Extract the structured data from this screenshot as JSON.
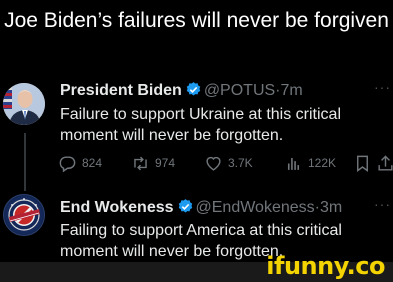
{
  "headline": "Joe Biden’s failures will never be forgiven",
  "tweets": [
    {
      "display_name": "President Biden",
      "handle": "@POTUS",
      "separator": "·",
      "time": "7m",
      "more": "···",
      "text_lines": [
        "Failure to support Ukraine at this critical",
        "moment will never be forgotten."
      ],
      "avatar_icon": "president-portrait",
      "verified_icon": "verified-badge-icon",
      "metrics": {
        "replies": "824",
        "retweets": "974",
        "likes": "3.7K",
        "views": "122K"
      }
    },
    {
      "display_name": "End Wokeness",
      "handle": "@EndWokeness",
      "separator": "·",
      "time": "3m",
      "more": "···",
      "text_lines": [
        "Failing to support America at this critical",
        "moment will never be forgotten."
      ],
      "avatar_icon": "end-wokeness-seal",
      "verified_icon": "verified-badge-icon"
    }
  ],
  "watermark": "ifunny.co",
  "colors": {
    "background": "#000000",
    "text": "#e7e9ea",
    "muted": "#71767b",
    "verified": "#1d9bf0",
    "watermark": "#f4d400"
  }
}
